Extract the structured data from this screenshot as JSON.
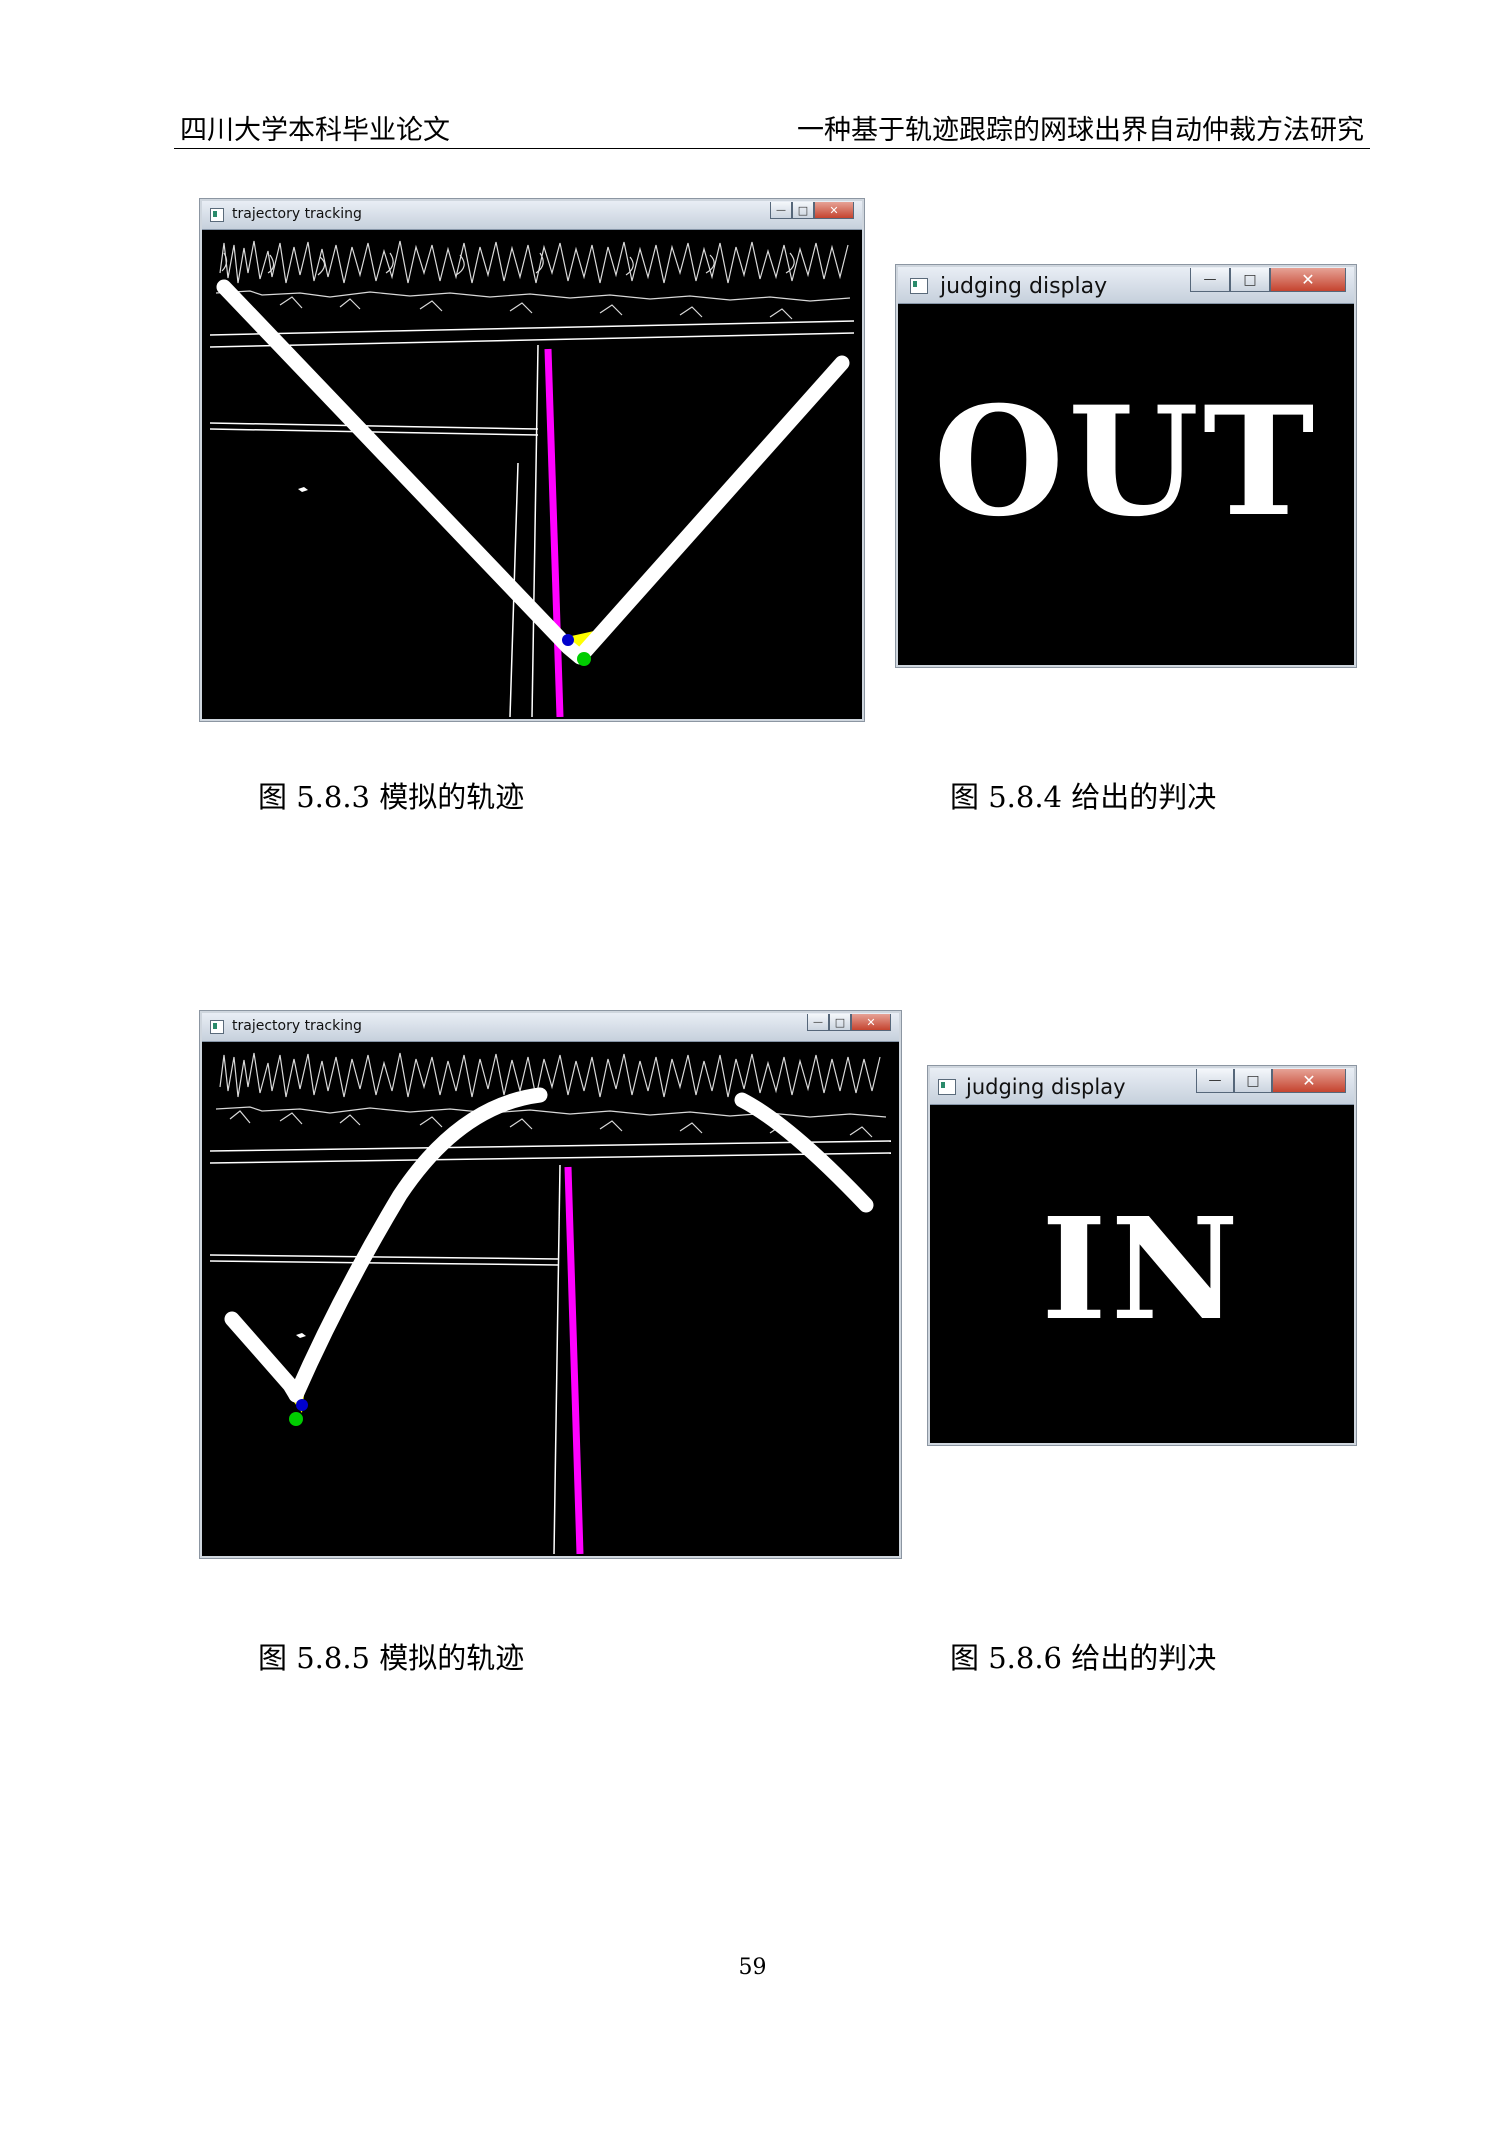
{
  "header": {
    "left": "四川大学本科毕业论文",
    "right": "一种基于轨迹跟踪的网球出界自动仲裁方法研究"
  },
  "figures": [
    {
      "window_title": "trajectory tracking",
      "caption": "图 5.8.3 模拟的轨迹"
    },
    {
      "window_title": "judging display",
      "verdict": "OUT",
      "caption": "图 5.8.4 给出的判决"
    },
    {
      "window_title": "trajectory tracking",
      "caption": "图 5.8.5 模拟的轨迹"
    },
    {
      "window_title": "judging display",
      "verdict": "IN",
      "caption": "图 5.8.6 给出的判决"
    }
  ],
  "window_controls": {
    "minimize": "—",
    "maximize": "□",
    "close": "✕"
  },
  "colors": {
    "court_line": "#ff00ff",
    "trajectory": "#ffffff",
    "bounce_zone": "#ffff00",
    "marker_blue": "#0000cc",
    "marker_green": "#00cc00"
  },
  "page_number": "59"
}
